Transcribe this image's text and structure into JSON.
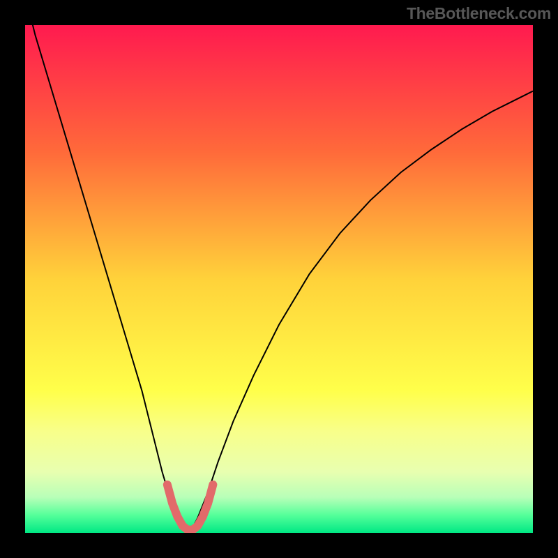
{
  "watermark": "TheBottleneck.com",
  "chart_data": {
    "type": "line",
    "title": "",
    "xlabel": "",
    "ylabel": "",
    "xlim": [
      0,
      100
    ],
    "ylim": [
      0,
      100
    ],
    "gradient_stops": [
      {
        "offset": 0,
        "color": "#ff1a4f"
      },
      {
        "offset": 0.25,
        "color": "#ff6a3a"
      },
      {
        "offset": 0.5,
        "color": "#ffd23a"
      },
      {
        "offset": 0.72,
        "color": "#ffff4a"
      },
      {
        "offset": 0.8,
        "color": "#f8ff8a"
      },
      {
        "offset": 0.88,
        "color": "#e8ffb0"
      },
      {
        "offset": 0.93,
        "color": "#b8ffb8"
      },
      {
        "offset": 0.965,
        "color": "#55ff9a"
      },
      {
        "offset": 1.0,
        "color": "#00e884"
      }
    ],
    "series": [
      {
        "name": "curve",
        "color": "#000000",
        "width": 2,
        "x": [
          0,
          2,
          5,
          8,
          11,
          14,
          17,
          20,
          23,
          25,
          27,
          28.5,
          30,
          31,
          32,
          33,
          34,
          36,
          38,
          41,
          45,
          50,
          56,
          62,
          68,
          74,
          80,
          86,
          92,
          98,
          100
        ],
        "y": [
          106,
          98,
          88,
          78,
          68,
          58,
          48,
          38,
          28,
          20,
          12,
          7,
          3,
          1,
          0.4,
          1,
          3,
          8,
          14,
          22,
          31,
          41,
          51,
          59,
          65.5,
          71,
          75.5,
          79.5,
          83,
          86,
          87
        ]
      },
      {
        "name": "marker-band",
        "color": "#e26a6a",
        "width": 12,
        "x": [
          28,
          29,
          30,
          31,
          32,
          33,
          34,
          35,
          36,
          37
        ],
        "y": [
          9.5,
          5.8,
          3.2,
          1.4,
          0.6,
          0.6,
          1.4,
          3.2,
          5.8,
          9.5
        ]
      }
    ]
  }
}
